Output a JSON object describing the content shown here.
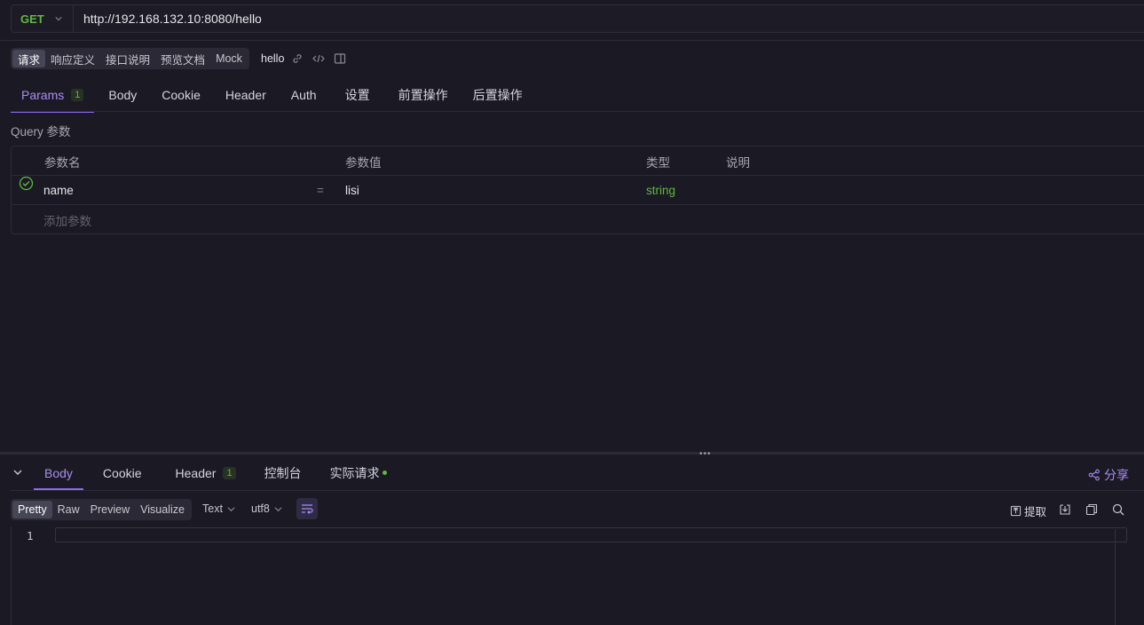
{
  "request": {
    "method": "GET",
    "url": "http://192.168.132.10:8080/hello"
  },
  "doc_tabs": [
    "请求",
    "响应定义",
    "接口说明",
    "预览文档",
    "Mock"
  ],
  "api_name": "hello",
  "request_tabs": [
    {
      "label": "Params",
      "badge": "1"
    },
    {
      "label": "Body"
    },
    {
      "label": "Cookie"
    },
    {
      "label": "Header"
    },
    {
      "label": "Auth"
    },
    {
      "label": "设置"
    },
    {
      "label": "前置操作"
    },
    {
      "label": "后置操作"
    }
  ],
  "query": {
    "section_label": "Query 参数",
    "columns": [
      "参数名",
      "参数值",
      "类型",
      "说明"
    ],
    "rows": [
      {
        "name": "name",
        "eq": "=",
        "value": "lisi",
        "type": "string",
        "desc": ""
      }
    ],
    "add_placeholder": "添加参数"
  },
  "response": {
    "tabs": [
      {
        "label": "Body"
      },
      {
        "label": "Cookie"
      },
      {
        "label": "Header",
        "badge": "1"
      },
      {
        "label": "控制台"
      },
      {
        "label": "实际请求"
      }
    ],
    "share_label": "分享",
    "formats": [
      "Pretty",
      "Raw",
      "Preview",
      "Visualize"
    ],
    "content_type": "Text",
    "encoding": "utf8",
    "extract_label": "提取",
    "line_number": "1"
  },
  "colors": {
    "accent": "#8c6be8",
    "success": "#5fb840",
    "background": "#1b1a24"
  }
}
